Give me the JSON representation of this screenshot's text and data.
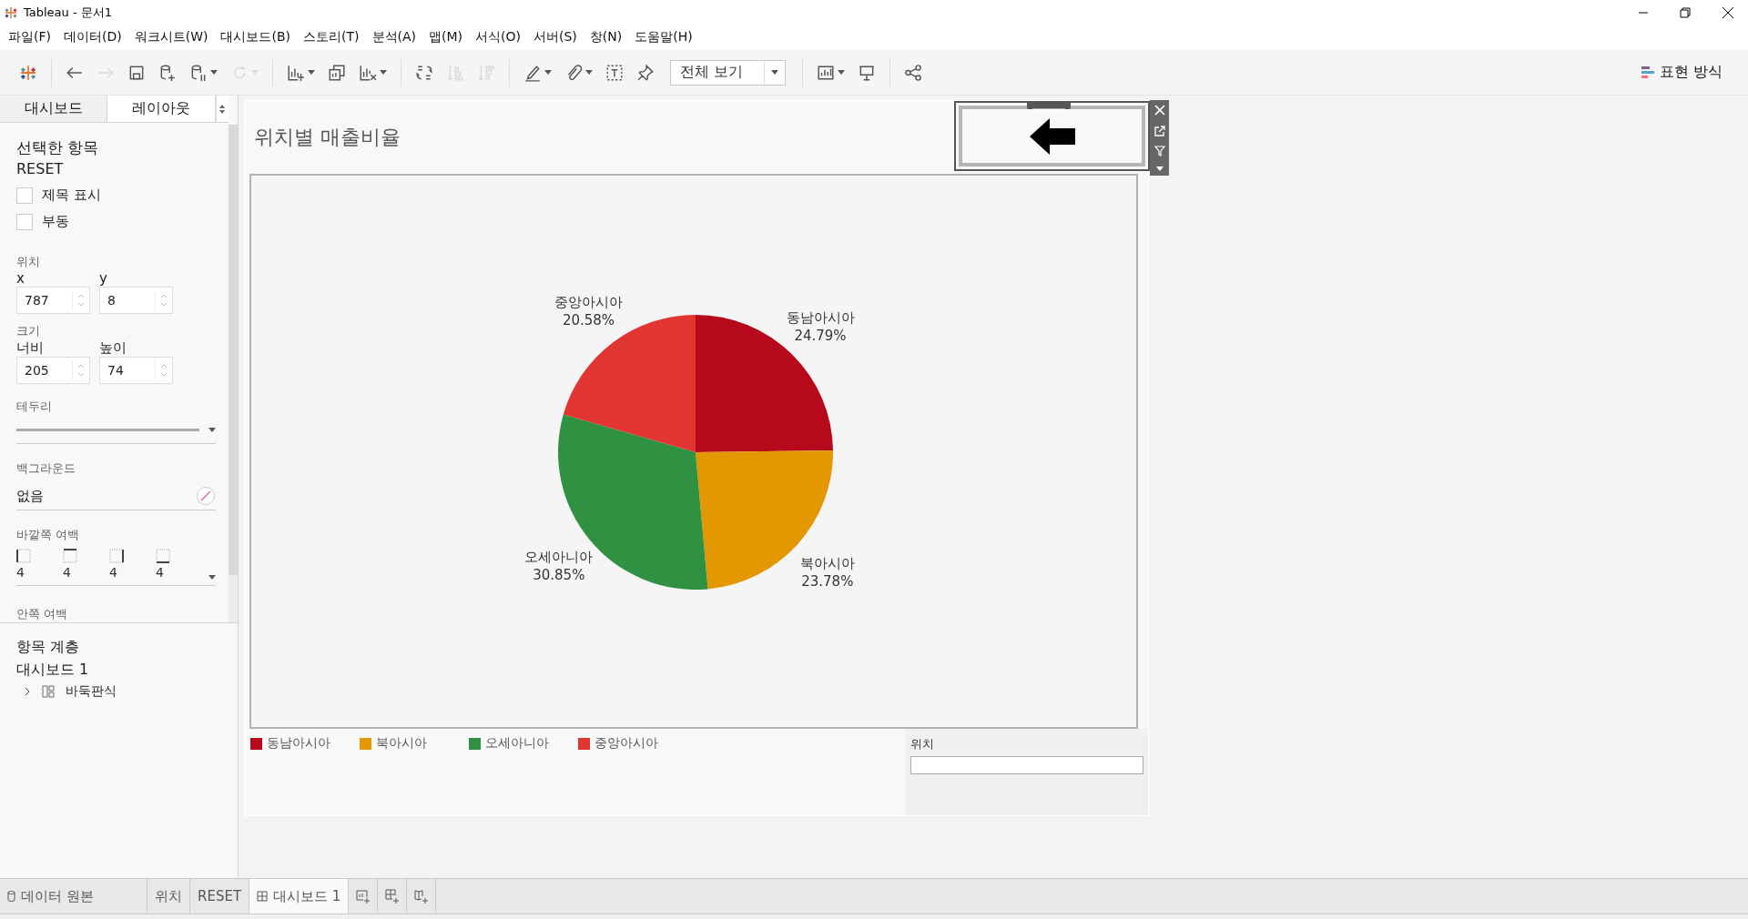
{
  "window": {
    "title": "Tableau - 문서1"
  },
  "menu": [
    "파일(F)",
    "데이터(D)",
    "워크시트(W)",
    "대시보드(B)",
    "스토리(T)",
    "분석(A)",
    "맵(M)",
    "서식(O)",
    "서버(S)",
    "창(N)",
    "도움말(H)"
  ],
  "toolbar": {
    "groups": [
      [
        {
          "kind": "logo",
          "disabled": false,
          "dropdown": false
        }
      ],
      [
        {
          "kind": "back",
          "disabled": false,
          "dropdown": false
        },
        {
          "kind": "forward",
          "disabled": true,
          "dropdown": false
        },
        {
          "kind": "save",
          "disabled": false,
          "dropdown": false
        },
        {
          "kind": "add-source",
          "disabled": false,
          "dropdown": false
        },
        {
          "kind": "pause-source",
          "disabled": false,
          "dropdown": true
        },
        {
          "kind": "refresh",
          "disabled": true,
          "dropdown": true
        }
      ],
      [
        {
          "kind": "new-sheet",
          "disabled": false,
          "dropdown": true
        },
        {
          "kind": "duplicate",
          "disabled": false,
          "dropdown": false
        },
        {
          "kind": "clear",
          "disabled": false,
          "dropdown": true
        }
      ],
      [
        {
          "kind": "swap",
          "disabled": false,
          "dropdown": false
        },
        {
          "kind": "sort-asc",
          "disabled": true,
          "dropdown": false
        },
        {
          "kind": "sort-desc",
          "disabled": true,
          "dropdown": false
        }
      ],
      [
        {
          "kind": "highlight",
          "disabled": false,
          "dropdown": true
        },
        {
          "kind": "clip",
          "disabled": false,
          "dropdown": true
        },
        {
          "kind": "text",
          "disabled": false,
          "dropdown": false
        },
        {
          "kind": "pin",
          "disabled": false,
          "dropdown": false
        },
        {
          "kind": "fit-select",
          "value": "전체 보기",
          "disabled": false,
          "dropdown": true
        }
      ],
      [
        {
          "kind": "show-labels",
          "disabled": false,
          "dropdown": true
        },
        {
          "kind": "presentation",
          "disabled": false,
          "dropdown": false
        }
      ],
      [
        {
          "kind": "share",
          "disabled": false,
          "dropdown": false
        }
      ]
    ],
    "show_me": {
      "label": "표현 방식"
    }
  },
  "panel": {
    "tabs": [
      {
        "label": "대시보드",
        "selected": false
      },
      {
        "label": "레이아웃",
        "selected": true
      }
    ],
    "selected_item": {
      "heading": "선택한 항목",
      "name": "RESET"
    },
    "checkboxes": [
      {
        "label": "제목 표시",
        "checked": false
      },
      {
        "label": "부동",
        "checked": false
      }
    ],
    "position": {
      "label": "위치",
      "fields": [
        {
          "label": "x",
          "value": "787"
        },
        {
          "label": "y",
          "value": "8"
        }
      ]
    },
    "size": {
      "label": "크기",
      "fields": [
        {
          "label": "너비",
          "value": "205"
        },
        {
          "label": "높이",
          "value": "74"
        }
      ]
    },
    "border": {
      "label": "테두리"
    },
    "background": {
      "label": "백그라운드",
      "value": "없음"
    },
    "outer_padding": {
      "label": "바깥쪽 여백",
      "values": [
        "4",
        "4",
        "4",
        "4"
      ]
    },
    "inner_padding": {
      "label": "안쪽 여백"
    }
  },
  "hierarchy": {
    "heading": "항목 계층",
    "root": "대시보드 1",
    "children": [
      {
        "label": "바둑판식",
        "expanded": false
      }
    ]
  },
  "dashboard": {
    "title": "위치별 매출비율",
    "chart_data": {
      "type": "pie",
      "categories": [
        "동남아시아",
        "북아시아",
        "오세아니아",
        "중앙아시아"
      ],
      "values": [
        24.79,
        23.78,
        30.85,
        20.58
      ],
      "colors": [
        "#b60a1c",
        "#e39802",
        "#309143",
        "#e03531"
      ],
      "data_labels": true,
      "value_labels": [
        "24.79%",
        "23.78%",
        "30.85%",
        "20.58%"
      ]
    },
    "legend": [
      {
        "label": "동남아시아",
        "color": "#b60a1c"
      },
      {
        "label": "북아시아",
        "color": "#e39802"
      },
      {
        "label": "오세아니아",
        "color": "#309143"
      },
      {
        "label": "중앙아시아",
        "color": "#e03531"
      }
    ],
    "filter": {
      "label": "위치"
    }
  },
  "bottom_tabs": {
    "data_source": "데이터 원본",
    "sheets": [
      {
        "label": "위치",
        "kind": "worksheet",
        "selected": false
      },
      {
        "label": "RESET",
        "kind": "worksheet",
        "selected": false
      },
      {
        "label": "대시보드 1",
        "kind": "dashboard",
        "selected": true
      }
    ]
  }
}
